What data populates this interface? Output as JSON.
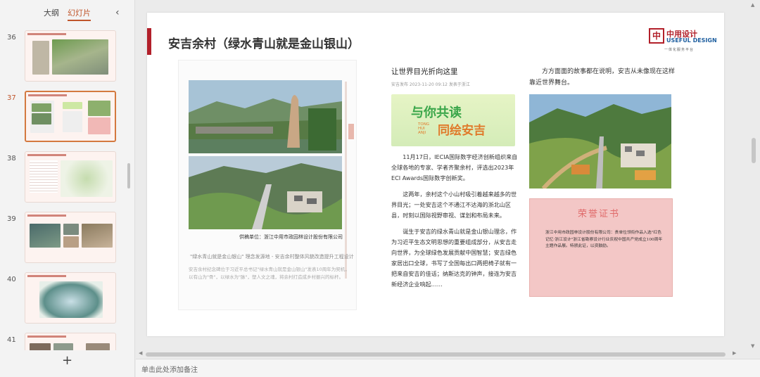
{
  "panel": {
    "tabs": [
      {
        "label": "大纲",
        "active": false
      },
      {
        "label": "幻灯片",
        "active": true
      }
    ],
    "collapse_icon": "chevron-left-icon",
    "add_icon": "plus-icon",
    "slides": [
      {
        "number": "36",
        "active": false
      },
      {
        "number": "37",
        "active": true
      },
      {
        "number": "38",
        "active": false
      },
      {
        "number": "39",
        "active": false
      },
      {
        "number": "40",
        "active": false
      },
      {
        "number": "41",
        "active": false
      }
    ]
  },
  "slide": {
    "title": "安吉余村（绿水青山就是金山银山）",
    "accent_color": "#b2202a",
    "logo": {
      "mark": "中",
      "cn": "中用设计",
      "en": "USEFUL DESIGN",
      "sub": "一体化服务平台"
    },
    "scan": {
      "caption": "供稿单位：浙江中用市政园林设计股份有限公司",
      "headline": "\"绿水青山就是金山银山\" 理念发源地 - 安吉余村整体风貌改造提升工程设计",
      "body": "安吉余村纪念碑位于习近平总书记\"绿水青山就是金山银山\"发表10周年为契机，以有山为\"骨\"，以绿水为\"脉\"，塑人文之魂，将余村打造成乡村振兴的标杆。"
    },
    "article": {
      "title": "让世界目光折向这里",
      "meta": "安吉发布  2023-11-20 09:12  发表于浙江",
      "banner_line1": "与你共读",
      "banner_line2": "同绘安吉",
      "banner_small": "TONG HUI ANJI",
      "paragraphs": [
        "11月17日，IECIA国际数字经济创新组织来自全球各地的专家、学者齐聚余村，评选出2023年ECI Awards国际数字创新奖。",
        "这两年，余村这个小山村吸引着越来越多的世界目光；一处安吉这个不通江不达海的浙北山区县，时刻以国际视野审视、谋划和布局未来。",
        "诞生于安吉的绿水青山就是金山银山理念，作为习近平生态文明思想的重要组成部分，从安吉走向世界，为全球绿色发展贡献中国智慧；安吉绿色家居出口全球，书写了全国每出口两把椅子就有一把来自安吉的佳话；纳斯达克的钟声，接连为安吉新经济企业响起……"
      ]
    },
    "right_text": "方方面面的故事都在说明，安吉从未像现在这样靠近世界舞台。",
    "certificate": {
      "heading": "荣誉证书",
      "body": "浙江中用市政园林设计股份有限公司：贵单位领衔作品入选\"红色记忆·浙江设计\"浙江省勘察设计行业庆祝中国共产党成立100周年主题作品展。特颁此证，以资鼓励。"
    }
  },
  "notes": {
    "placeholder": "单击此处添加备注"
  }
}
